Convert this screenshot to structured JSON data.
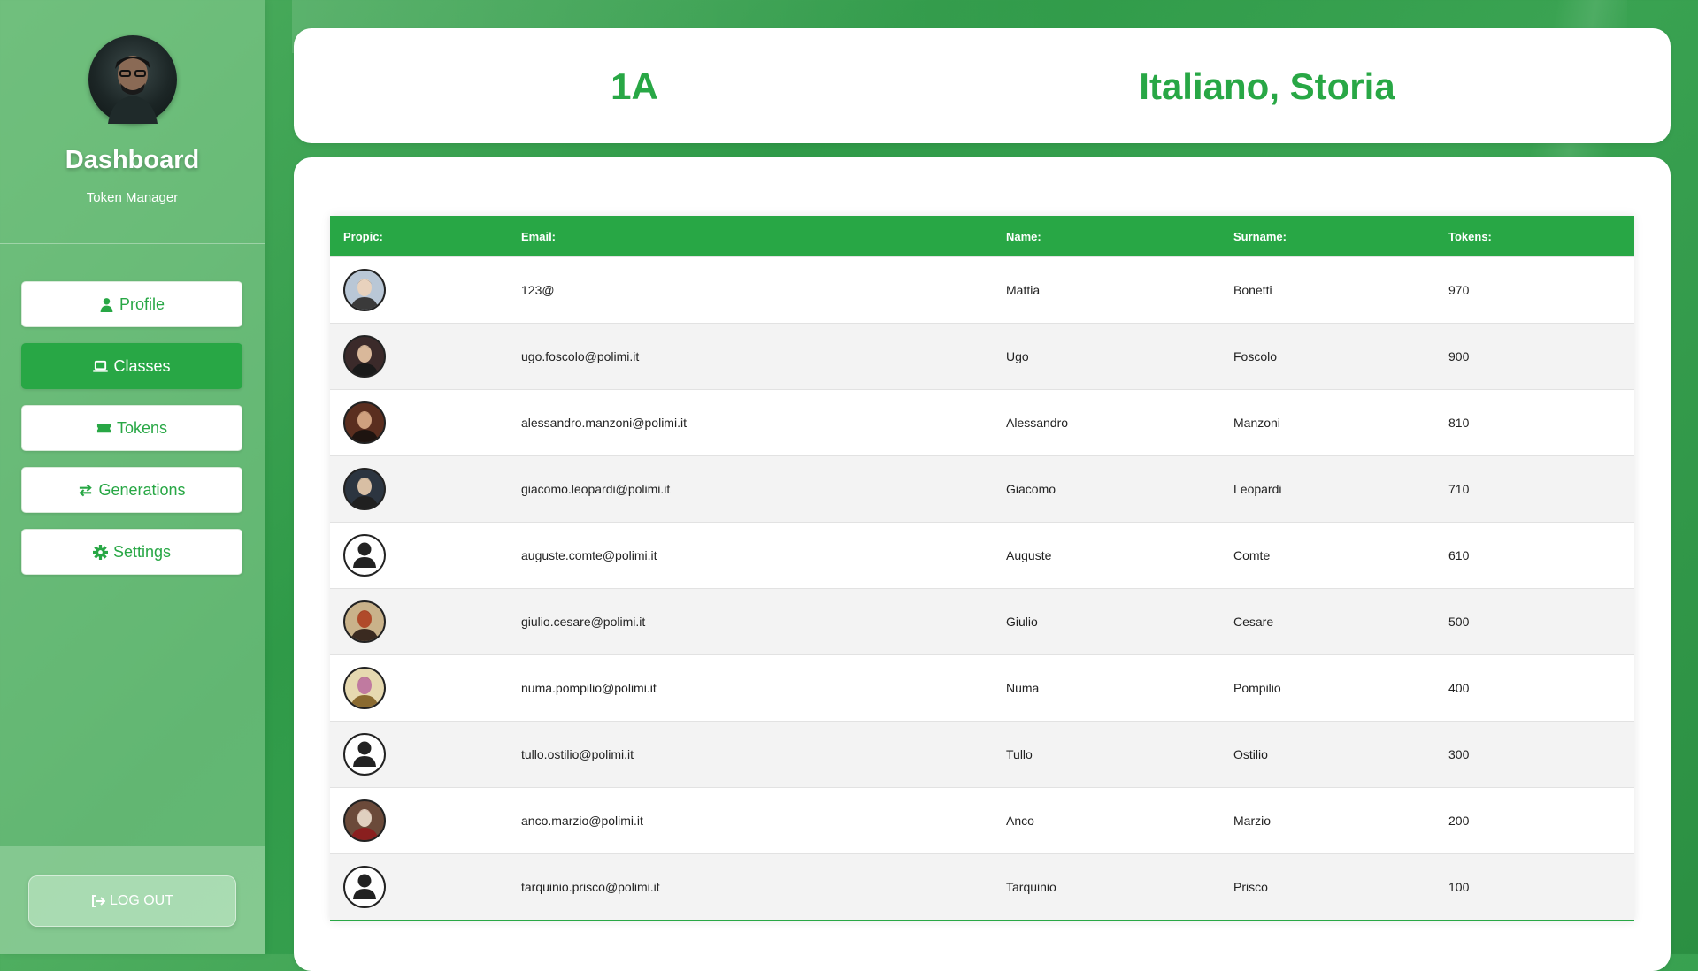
{
  "sidebar": {
    "title": "Dashboard",
    "subtitle": "Token Manager",
    "nav": [
      {
        "label": "Profile",
        "icon": "user-icon",
        "active": false
      },
      {
        "label": "Classes",
        "icon": "laptop-icon",
        "active": true
      },
      {
        "label": "Tokens",
        "icon": "ticket-icon",
        "active": false
      },
      {
        "label": "Generations",
        "icon": "exchange-icon",
        "active": false
      },
      {
        "label": "Settings",
        "icon": "gear-icon",
        "active": false
      }
    ],
    "logout_label": "LOG OUT"
  },
  "header": {
    "class_name": "1A",
    "subjects": "Italiano, Storia"
  },
  "table": {
    "headers": {
      "propic": "Propic:",
      "email": "Email:",
      "name": "Name:",
      "surname": "Surname:",
      "tokens": "Tokens:"
    },
    "rows": [
      {
        "email": "123@",
        "name": "Mattia",
        "surname": "Bonetti",
        "tokens": "970",
        "propic": "photo"
      },
      {
        "email": "ugo.foscolo@polimi.it",
        "name": "Ugo",
        "surname": "Foscolo",
        "tokens": "900",
        "propic": "photo"
      },
      {
        "email": "alessandro.manzoni@polimi.it",
        "name": "Alessandro",
        "surname": "Manzoni",
        "tokens": "810",
        "propic": "photo"
      },
      {
        "email": "giacomo.leopardi@polimi.it",
        "name": "Giacomo",
        "surname": "Leopardi",
        "tokens": "710",
        "propic": "photo"
      },
      {
        "email": "auguste.comte@polimi.it",
        "name": "Auguste",
        "surname": "Comte",
        "tokens": "610",
        "propic": "default"
      },
      {
        "email": "giulio.cesare@polimi.it",
        "name": "Giulio",
        "surname": "Cesare",
        "tokens": "500",
        "propic": "photo"
      },
      {
        "email": "numa.pompilio@polimi.it",
        "name": "Numa",
        "surname": "Pompilio",
        "tokens": "400",
        "propic": "photo"
      },
      {
        "email": "tullo.ostilio@polimi.it",
        "name": "Tullo",
        "surname": "Ostilio",
        "tokens": "300",
        "propic": "default"
      },
      {
        "email": "anco.marzio@polimi.it",
        "name": "Anco",
        "surname": "Marzio",
        "tokens": "200",
        "propic": "photo"
      },
      {
        "email": "tarquinio.prisco@polimi.it",
        "name": "Tarquinio",
        "surname": "Prisco",
        "tokens": "100",
        "propic": "default"
      }
    ]
  },
  "colors": {
    "accent": "#28a745",
    "row_alt": "#f3f3f3"
  }
}
